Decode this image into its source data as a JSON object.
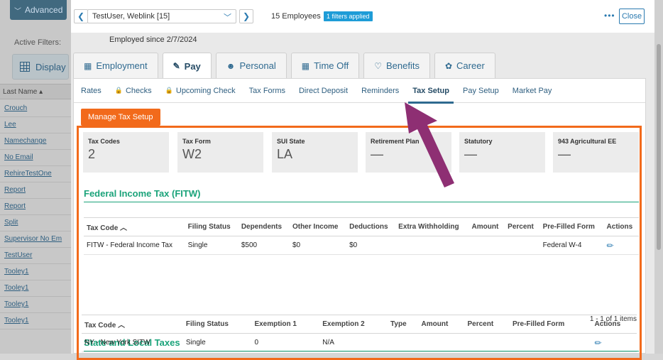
{
  "left": {
    "advanced_label": "Advanced",
    "active_filters_label": "Active Filters:",
    "display_label": "Display",
    "last_name_header": "Last Name ▴",
    "employees": [
      "Crouch",
      "Lee",
      "Namechange",
      "No Email",
      "RehireTestOne",
      "Report",
      "Report",
      "Split",
      "Supervisor No Em",
      "TestUser",
      "Tooley1",
      "Tooley1",
      "Tooley1",
      "Tooley1"
    ]
  },
  "topbar": {
    "employee_selected": "TestUser, Weblink [15]",
    "employee_count": "15 Employees",
    "filters_badge": "1 filters applied",
    "more_label": "•••",
    "close_label": "Close",
    "employed_since": "Employed since 2/7/2024"
  },
  "main_tabs": [
    {
      "label": "Employment",
      "icon": "building-icon"
    },
    {
      "label": "Pay",
      "icon": "pay-icon"
    },
    {
      "label": "Personal",
      "icon": "person-icon"
    },
    {
      "label": "Time Off",
      "icon": "calendar-icon"
    },
    {
      "label": "Benefits",
      "icon": "heart-icon"
    },
    {
      "label": "Career",
      "icon": "career-icon"
    }
  ],
  "sub_tabs": [
    {
      "label": "Rates",
      "locked": false
    },
    {
      "label": "Checks",
      "locked": true
    },
    {
      "label": "Upcoming Check",
      "locked": true
    },
    {
      "label": "Tax Forms",
      "locked": false
    },
    {
      "label": "Direct Deposit",
      "locked": false
    },
    {
      "label": "Reminders",
      "locked": false
    },
    {
      "label": "Tax Setup",
      "locked": false
    },
    {
      "label": "Pay Setup",
      "locked": false
    },
    {
      "label": "Market Pay",
      "locked": false
    }
  ],
  "manage_button": "Manage Tax Setup",
  "cards": [
    {
      "label": "Tax Codes",
      "value": "2"
    },
    {
      "label": "Tax Form",
      "value": "W2"
    },
    {
      "label": "SUI State",
      "value": "LA"
    },
    {
      "label": "Retirement Plan",
      "value": "—"
    },
    {
      "label": "Statutory",
      "value": "—"
    },
    {
      "label": "943 Agricultural EE",
      "value": "—"
    }
  ],
  "fitw": {
    "title": "Federal Income Tax (FITW)",
    "headers": [
      "Tax Code  ︿",
      "Filing Status",
      "Dependents",
      "Other Income",
      "Deductions",
      "Extra Withholding",
      "Amount",
      "Percent",
      "Pre-Filled Form",
      "Actions"
    ],
    "row": {
      "tax_code": "FITW - Federal Income Tax",
      "filing_status": "Single",
      "dependents": "$500",
      "other_income": "$0",
      "deductions": "$0",
      "extra_withholding": "",
      "amount": "",
      "percent": "",
      "form": "Federal W-4"
    },
    "pager": "1 - 1 of 1 items"
  },
  "state": {
    "title": "State and Local Taxes",
    "headers": [
      "Tax Code  ︿",
      "Filing Status",
      "Exemption 1",
      "Exemption 2",
      "Type",
      "Amount",
      "Percent",
      "Pre-Filled Form",
      "Actions"
    ],
    "row": {
      "tax_code": "NY - New York SITW",
      "filing_status": "Single",
      "exemption1": "0",
      "exemption2": "N/A"
    }
  },
  "colors": {
    "accent": "#f26a1b",
    "section": "#1aa37a",
    "link": "#2a7ab0",
    "annotation": "#8e2f73"
  }
}
